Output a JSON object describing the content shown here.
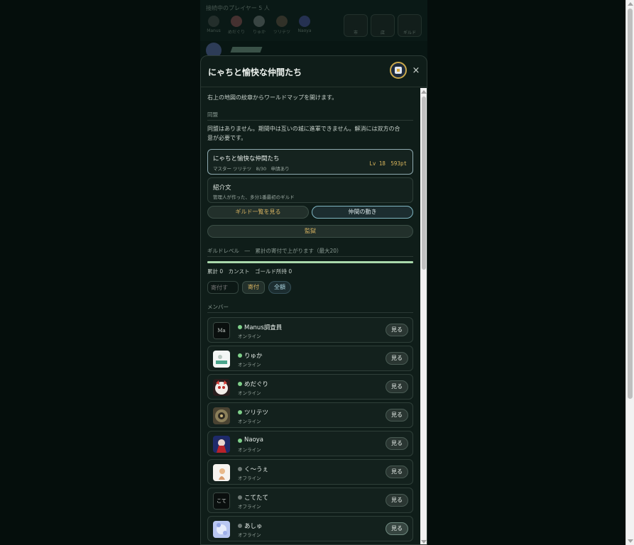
{
  "background": {
    "title": "接続中のプレイヤー 5 人",
    "players": [
      "Manus",
      "めだぐり",
      "りゅか",
      "ツリテツ",
      "Naoya"
    ],
    "buttons": [
      "市",
      "店",
      "ギルド"
    ]
  },
  "modal": {
    "title": "にゃちと愉快な仲間たち",
    "close": "×",
    "map_hint": "右上の地図の紋章からワールドマップを開けます。",
    "alliance_section": "同盟",
    "alliance_text_1": "同盟はありません。期間中は互いの城に進軍できません。解消には双方の合",
    "alliance_text_2": "意が必要です。",
    "guild_card": {
      "name": "にゃちと愉快な仲間たち",
      "meta": "マスター ツリテツ　8/30　申請あり",
      "level": "Lv 18　593pt"
    },
    "intro": {
      "title": "紹介文",
      "text": "管理人が作った、多分1番最初のギルド"
    },
    "buttons": {
      "guild_list": "ギルド一覧を見る",
      "member_activity": "仲間の動き",
      "prison": "監獄"
    },
    "guild_level_label": "ギルドレベル　―　累計の寄付で上がります（最大20）",
    "progress_percent": 100,
    "stats": "累計 0　カンスト　ゴールド所持 0",
    "donate": {
      "placeholder": "寄付す",
      "donate_button": "寄付",
      "all_button": "全額"
    },
    "members_section": "メンバー",
    "view_label": "見る",
    "members": [
      {
        "name": "Manus調査員",
        "status": "オンライン",
        "online": true,
        "avatar_text": "Ma"
      },
      {
        "name": "りゅか",
        "status": "オンライン",
        "online": true,
        "avatar_text": ""
      },
      {
        "name": "めだぐり",
        "status": "オンライン",
        "online": true,
        "avatar_text": ""
      },
      {
        "name": "ツリテツ",
        "status": "オンライン",
        "online": true,
        "avatar_text": ""
      },
      {
        "name": "Naoya",
        "status": "オンライン",
        "online": true,
        "avatar_text": ""
      },
      {
        "name": "く〜うぇ",
        "status": "オフライン",
        "online": false,
        "avatar_text": ""
      },
      {
        "name": "こてたて",
        "status": "オフライン",
        "online": false,
        "avatar_text": "こて"
      },
      {
        "name": "あしゅ",
        "status": "オフライン",
        "online": false,
        "avatar_text": ""
      }
    ]
  },
  "colors": {
    "online_dot": "#7fd08a",
    "offline_dot": "#6f7a76",
    "gold": "#d6b260",
    "teal_border": "#7fb6c2"
  }
}
